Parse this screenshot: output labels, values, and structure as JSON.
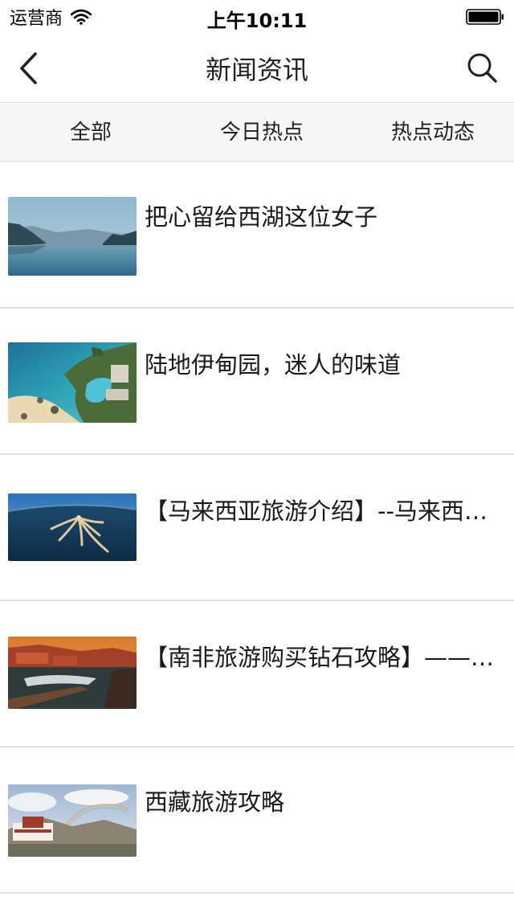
{
  "status_bar": {
    "carrier": "运营商",
    "time": "上午10:11",
    "icons": [
      "wifi-icon",
      "battery-icon"
    ]
  },
  "nav": {
    "title": "新闻资讯",
    "back_icon": "chevron-left-icon",
    "search_icon": "search-icon"
  },
  "tabs": [
    {
      "label": "全部"
    },
    {
      "label": "今日热点"
    },
    {
      "label": "热点动态"
    }
  ],
  "news": [
    {
      "title": "把心留给西湖这位女子",
      "thumbnail": "misty-lake-landscape"
    },
    {
      "title": "陆地伊甸园，迷人的味道",
      "thumbnail": "coastal-resort-pool"
    },
    {
      "title": "【马来西亚旅游介绍】--马来西亚旅游介绍",
      "thumbnail": "palm-shaped-water-villas"
    },
    {
      "title": "【南非旅游购买钻石攻略】——南非旅游购买钻石攻略",
      "thumbnail": "harbour-sunset-pier"
    },
    {
      "title": "西藏旅游攻略",
      "thumbnail": "potala-palace-rainbow"
    }
  ]
}
